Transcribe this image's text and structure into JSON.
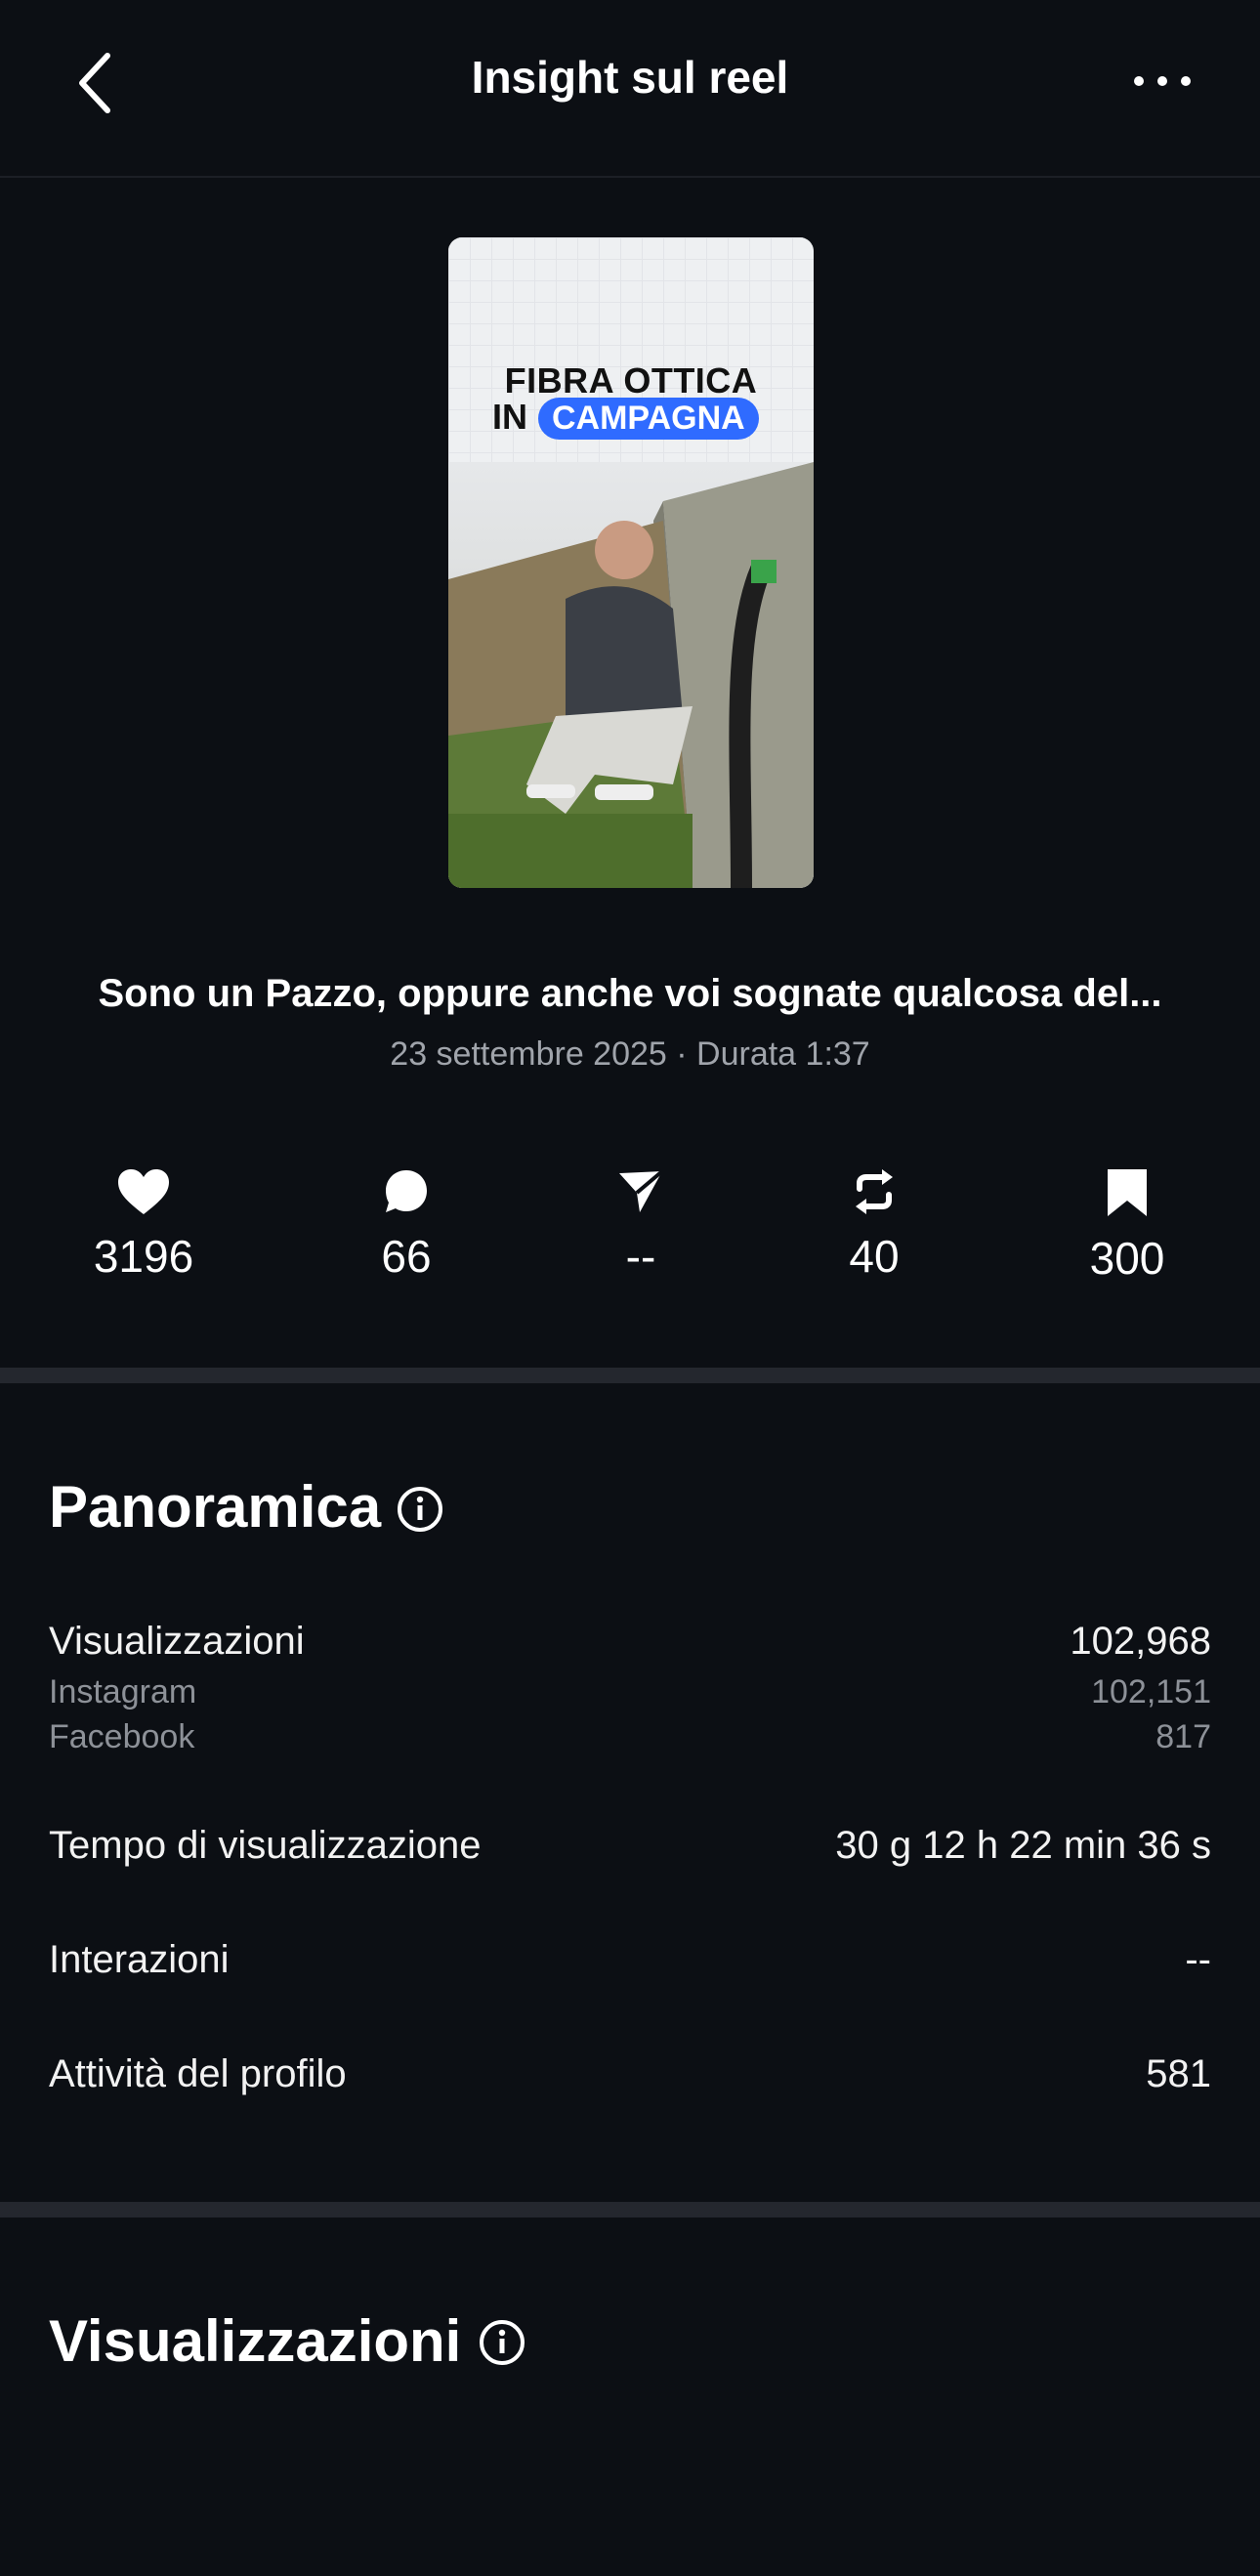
{
  "header": {
    "title": "Insight sul reel"
  },
  "thumbnail": {
    "line1": "FIBRA OTTICA",
    "line2_prefix": "IN",
    "line2_highlight": "CAMPAGNA"
  },
  "reel": {
    "caption": "Sono un Pazzo, oppure anche voi sognate qualcosa del...",
    "meta": "23 settembre 2025 · Durata 1:37"
  },
  "stats": {
    "likes": "3196",
    "comments": "66",
    "shares": "--",
    "reposts": "40",
    "saves": "300"
  },
  "overview": {
    "title": "Panoramica",
    "views_label": "Visualizzazioni",
    "views_value": "102,968",
    "instagram_label": "Instagram",
    "instagram_value": "102,151",
    "facebook_label": "Facebook",
    "facebook_value": "817",
    "watch_time_label": "Tempo di visualizzazione",
    "watch_time_value": "30 g 12 h 22 min 36 s",
    "interactions_label": "Interazioni",
    "interactions_value": "--",
    "profile_activity_label": "Attività del profilo",
    "profile_activity_value": "581"
  },
  "views_section": {
    "title": "Visualizzazioni"
  },
  "colors": {
    "background": "#0c0f14",
    "divider": "#24272e",
    "muted": "#a0a4ab",
    "accent": "#2f6bff"
  }
}
